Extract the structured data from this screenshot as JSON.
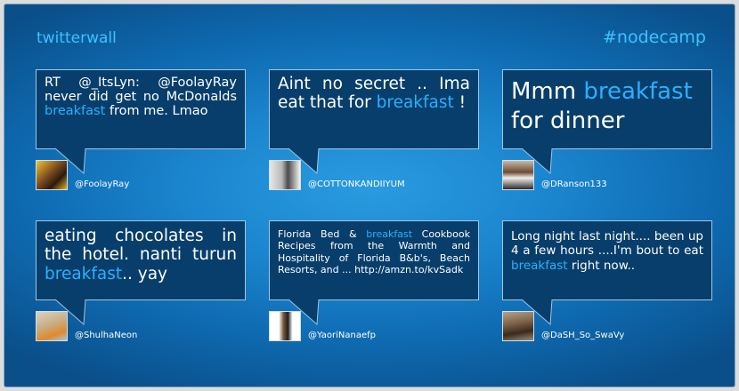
{
  "header": {
    "brand": "twitterwall",
    "hashtag": "#nodecamp"
  },
  "colors": {
    "accent": "#38c5ff",
    "highlight": "#2ab0ff",
    "bubble": "#083e6b"
  },
  "tweets": [
    {
      "before": "RT @_ItsLyn: @FoolayRay never did get no McDonalds ",
      "keyword": "breakfast",
      "after": " from me. Lmao",
      "handle": "@FoolayRay"
    },
    {
      "before": "Aint no secret .. Ima eat that for ",
      "keyword": "breakfast",
      "after": " !",
      "handle": "@COTTONKANDIIYUM"
    },
    {
      "before": "Mmm ",
      "keyword": "breakfast",
      "after": " for dinner",
      "handle": "@DRanson133"
    },
    {
      "before": "eating chocolates in the hotel. nanti turun ",
      "keyword": "breakfast",
      "after": ".. yay",
      "handle": "@ShulhaNeon"
    },
    {
      "before": "Florida Bed & ",
      "keyword": "breakfast",
      "after": " Cookbook Recipes from the Warmth and Hospitality of Florida B&b's, Beach Resorts, and ... http://amzn.to/kvSadk",
      "handle": "@YaoriNanaefp"
    },
    {
      "before": "Long night last night.... been up 4 a few hours ....I'm bout to eat ",
      "keyword": "breakfast",
      "after": " right now..",
      "handle": "@DaSH_So_SwaVy"
    }
  ]
}
